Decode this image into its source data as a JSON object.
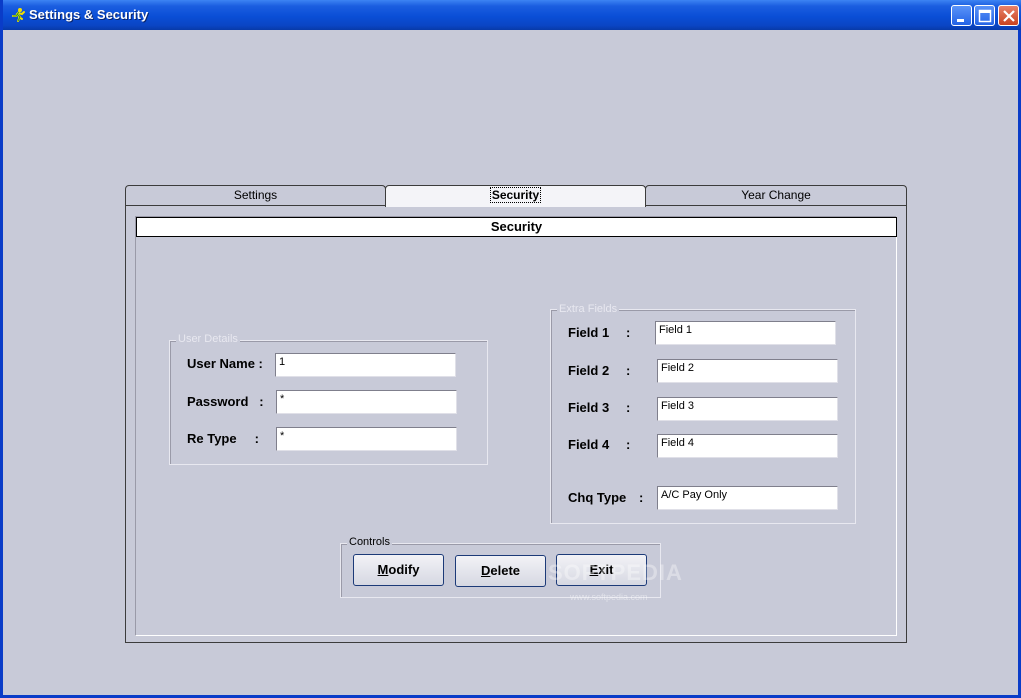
{
  "window": {
    "title": "Settings & Security"
  },
  "tabs": [
    {
      "label": "Settings",
      "active": false
    },
    {
      "label": "Security",
      "active": true
    },
    {
      "label": "Year Change",
      "active": false
    }
  ],
  "section": {
    "header": "Security"
  },
  "user_details": {
    "legend": "User Details",
    "fields": [
      {
        "label": "User Name :",
        "value": "1"
      },
      {
        "label": "Password   :",
        "value": "*"
      },
      {
        "label": "Re Type     :",
        "value": "*"
      }
    ]
  },
  "extra_fields": {
    "legend": "Extra Fields",
    "fields": [
      {
        "label": "Field 1",
        "colon": ":",
        "value": "Field 1"
      },
      {
        "label": "Field 2",
        "colon": ":",
        "value": "Field 2"
      },
      {
        "label": "Field 3",
        "colon": ":",
        "value": "Field 3"
      },
      {
        "label": "Field 4",
        "colon": ":",
        "value": "Field 4"
      },
      {
        "label": "Chq Type",
        "colon": ":",
        "value": "A/C Pay Only"
      }
    ]
  },
  "controls": {
    "legend": "Controls",
    "buttons": [
      {
        "first": "M",
        "rest": "odify"
      },
      {
        "first": "D",
        "rest": "elete"
      },
      {
        "first": "E",
        "rest": "xit"
      }
    ]
  },
  "watermark": {
    "brand": "SOFTPEDIA",
    "url": "www.softpedia.com"
  },
  "colors": {
    "titlebar": "#0a4ed6",
    "background": "#c8cad8",
    "close_button": "#c9431f"
  }
}
